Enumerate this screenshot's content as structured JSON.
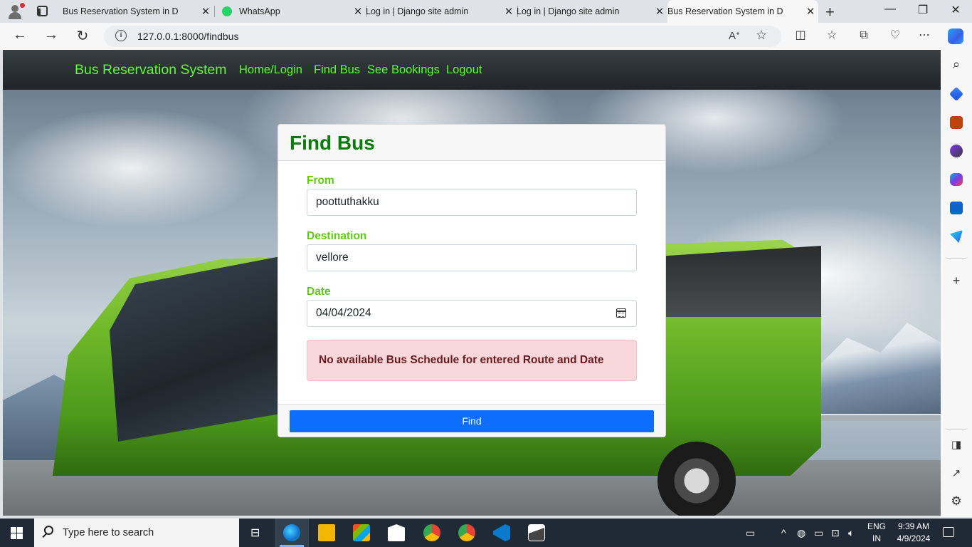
{
  "browser": {
    "tabs": [
      {
        "title": "Bus Reservation System in D",
        "favicon": "page-icon",
        "active": false
      },
      {
        "title": "WhatsApp",
        "favicon": "whatsapp-icon",
        "active": false
      },
      {
        "title": "Log in | Django site admin",
        "favicon": "page-icon",
        "active": false
      },
      {
        "title": "Log in | Django site admin",
        "favicon": "page-icon",
        "active": false
      },
      {
        "title": "Bus Reservation System in D",
        "favicon": "page-icon",
        "active": true
      }
    ],
    "url": "127.0.0.1:8000/findbus",
    "notification_badge": "1"
  },
  "site": {
    "brand": "Bus Reservation System",
    "nav": [
      "Home/Login",
      "Find Bus",
      "See Bookings",
      "Logout"
    ],
    "accent_color": "#5cff2e"
  },
  "form": {
    "title": "Find Bus",
    "from_label": "From",
    "from_value": "poottuthakku",
    "destination_label": "Destination",
    "destination_value": "vellore",
    "date_label": "Date",
    "date_value": "04/04/2024",
    "alert": "No available Bus Schedule for entered Route and Date",
    "submit_label": "Find",
    "button_color": "#0d6efd"
  },
  "taskbar": {
    "search_placeholder": "Type here to search",
    "lang_line1": "ENG",
    "lang_line2": "IN",
    "time": "9:39 AM",
    "date": "4/9/2024"
  }
}
